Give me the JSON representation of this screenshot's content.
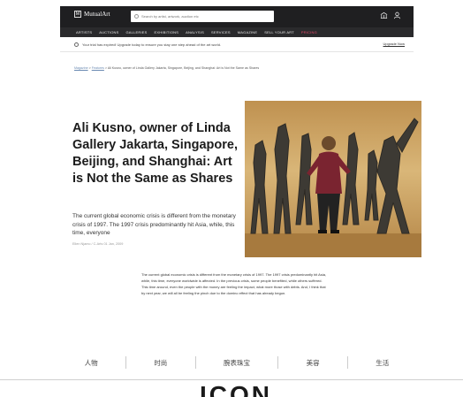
{
  "header": {
    "logo_mark": "M",
    "logo_text": "MutualArt",
    "search_placeholder": "Search by artist, artwork, auction etc",
    "icons": [
      "bank-icon",
      "user-icon"
    ]
  },
  "nav": {
    "items": [
      "ARTISTS",
      "AUCTIONS",
      "GALLERIES",
      "EXHIBITIONS",
      "ANALYSIS",
      "SERVICES",
      "MAGAZINE",
      "SELL YOUR ART",
      "PRICING"
    ]
  },
  "trial_banner": {
    "text": "Your trial has expired! Upgrade today to ensure you stay one step ahead of the art world.",
    "link": "Upgrade Now"
  },
  "breadcrumb": {
    "items": [
      "Magazine",
      "Features"
    ],
    "separator": ">",
    "current": "Ali Kusno, owner of Linda Gallery Jakarta, Singapore, Beijing, and Shanghai: Art is Not the Same as Shares"
  },
  "article": {
    "title": "Ali Kusno, owner of Linda Gallery Jakarta, Singapore, Beijing, and Shanghai: Art is Not the Same as Shares",
    "standfirst": "The current global economic crisis is different from the monetary crisis of 1997. The 1997 crisis predominantly hit Asia, while, this time, everyone",
    "byline": "Ellen Njamo / C-Arts 01 Jan, 2009",
    "body": "The current global economic crisis is different from the monetary crisis of 1997. The 1997 crisis predominantly hit Asia, while, this time, everyone worldwide is affected. In the previous crisis, some people benefited, while others suffered. This time around, even the people with the money are feeling the impact, what more those with debts. And, I think that by next year, we will all be feeling the pinch due to the domino effect that has already begun."
  },
  "categories": [
    "人物",
    "时尚",
    "腕表珠宝",
    "美容",
    "生活"
  ],
  "brand_logo": "ICON",
  "colors": {
    "header_bg": "#1f1f21",
    "nav_bg": "#2a2a2c",
    "pricing": "#e84a6a",
    "link": "#6b8bb3"
  }
}
